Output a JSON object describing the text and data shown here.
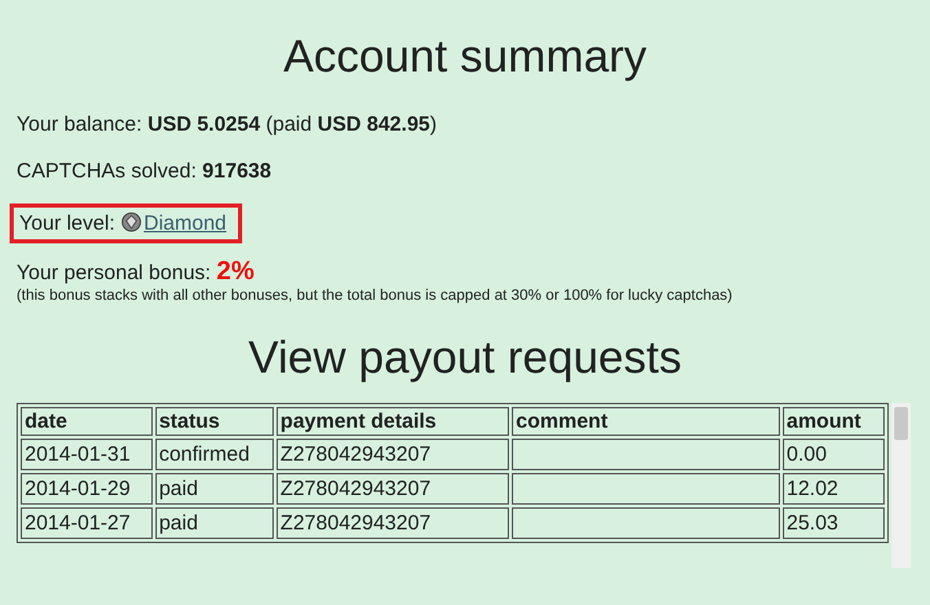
{
  "title": "Account summary",
  "balance": "Your balance: **USD 5.0254** (paid **USD 842.95**)",
  "captchas": "CAPTCHAs solved: **917638**",
  "level": {
    "label": "Your level:",
    "value": "Diamond",
    "highlighted": true
  },
  "bonus": {
    "label": "Your personal bonus:",
    "value": "2%",
    "note": "(this bonus stacks with all other bonuses, but the total bonus is capped at 30% or 100% for lucky captchas)"
  },
  "payouts": {
    "title": "View payout requests",
    "columns": [
      "date",
      "status",
      "payment details",
      "comment",
      "amount"
    ],
    "rows": [
      [
        "2014-01-31",
        "confirmed",
        "Z278042943207",
        "",
        "0.00"
      ],
      [
        "2014-01-29",
        "paid",
        "Z278042943207",
        "",
        "12.02"
      ],
      [
        "2014-01-27",
        "paid",
        "Z278042943207",
        "",
        "25.03"
      ]
    ]
  }
}
